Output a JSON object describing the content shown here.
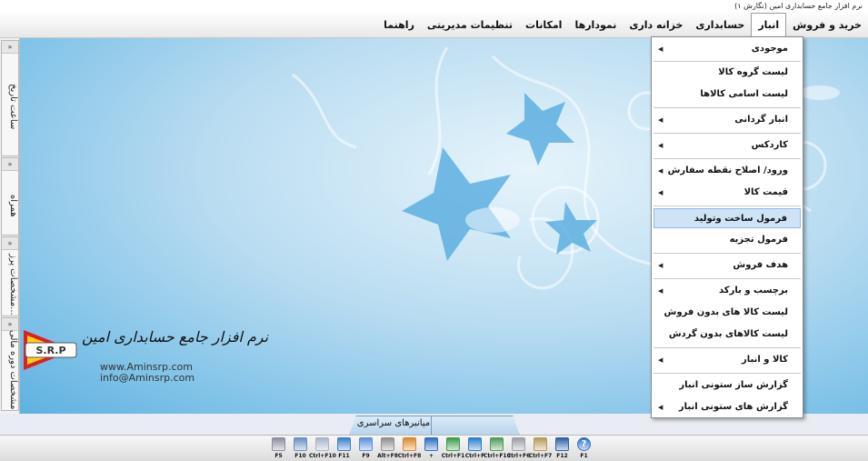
{
  "window": {
    "title": "نرم افزار جامع حسابداری امین (نگارش ۱)"
  },
  "menubar": {
    "items": [
      {
        "label": "خرید و فروش"
      },
      {
        "label": "انبار"
      },
      {
        "label": "حسابداری"
      },
      {
        "label": "خزانه داری"
      },
      {
        "label": "نمودارها"
      },
      {
        "label": "امکانات"
      },
      {
        "label": "تنظیمات مدیریتی"
      },
      {
        "label": "راهنما"
      }
    ],
    "active": "انبار"
  },
  "left_dock": {
    "panels": [
      {
        "label": "ساعت تاریخ",
        "arrow": "»"
      },
      {
        "label": "همراه",
        "arrow": "»"
      },
      {
        "label": "...مشخصات پرز",
        "arrow": "»"
      },
      {
        "label": "مشخصات دوره مالی",
        "arrow": "»"
      }
    ]
  },
  "dropdown": {
    "items": [
      {
        "label": "موجودی",
        "submenu": true
      },
      {
        "label": "لیست گروه کالا",
        "submenu": false
      },
      {
        "label": "لیست اسامی کالاها",
        "submenu": false
      },
      {
        "label": "انبار گردانی",
        "submenu": true
      },
      {
        "label": "کاردکس",
        "submenu": true
      },
      {
        "label": "ورود/ اصلاح نقطه سفارش",
        "submenu": true
      },
      {
        "label": "قیمت کالا",
        "submenu": true
      },
      {
        "label": "فرمول ساخت وتولید",
        "submenu": false,
        "highlight": true
      },
      {
        "label": "فرمول تجزیه",
        "submenu": false
      },
      {
        "label": "هدف فروش",
        "submenu": true
      },
      {
        "label": "برچسب و بارکد",
        "submenu": true
      },
      {
        "label": "لیست کالا های بدون فروش",
        "submenu": false
      },
      {
        "label": "لیست کالاهای بدون گردش",
        "submenu": false
      },
      {
        "label": "کالا و انبار",
        "submenu": true
      },
      {
        "label": "گزارش ساز ستونی انبار",
        "submenu": false
      },
      {
        "label": "گزارش های ستونی انبار",
        "submenu": true
      }
    ]
  },
  "logo": {
    "title": "نرم افزار جامع حسابداری امین",
    "badge": "S.R.P",
    "website": "www.Aminsrp.com",
    "email": "info@Aminsrp.com"
  },
  "bottom_tab": {
    "label": "میانبرهای سراسری"
  },
  "toolbar": {
    "buttons": [
      {
        "key": "F5",
        "icon": "calculator-icon",
        "color": "#8a8fa0"
      },
      {
        "key": "F10",
        "icon": "notepad-icon",
        "color": "#6a8fc2"
      },
      {
        "key": "Ctrl+F10",
        "icon": "document-list-icon",
        "color": "#a7b4c8"
      },
      {
        "key": "F11",
        "icon": "email-icon",
        "color": "#3b7fd0"
      },
      {
        "key": "F9",
        "icon": "search-icon",
        "color": "#5a8fd8"
      },
      {
        "key": "Alt+F8",
        "icon": "edit-document-icon",
        "color": "#8e8e8e"
      },
      {
        "key": "Ctrl+F8",
        "icon": "notebook-icon",
        "color": "#d98b2a"
      },
      {
        "key": "+",
        "icon": "form-add-icon",
        "color": "#2e6cc7"
      },
      {
        "key": "Ctrl+F1",
        "icon": "grid-table-icon",
        "color": "#3d9a4a"
      },
      {
        "key": "Ctrl+F",
        "icon": "network-icon",
        "color": "#2a7fc8"
      },
      {
        "key": "Ctrl+F10",
        "icon": "wallet-icon",
        "color": "#4f9b5a"
      },
      {
        "key": "Ctrl+F6",
        "icon": "pen-icon",
        "color": "#9a9ea8"
      },
      {
        "key": "Ctrl+F7",
        "icon": "money-icon",
        "color": "#b89a5a"
      },
      {
        "key": "F12",
        "icon": "monitor-icon",
        "color": "#2f5fa8"
      },
      {
        "key": "F1",
        "icon": "help-icon",
        "color": "#2d6fc9"
      }
    ]
  },
  "colors": {
    "desktop": "#7fc2e8",
    "highlight": "#cfe3f7"
  }
}
